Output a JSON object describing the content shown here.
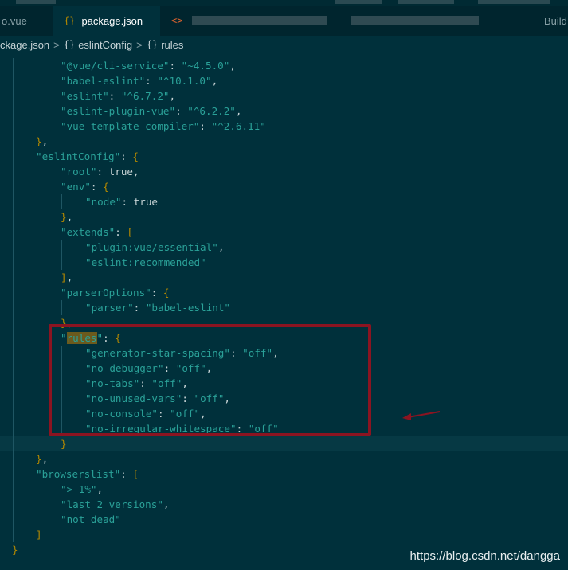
{
  "tabs": [
    {
      "label": "o.vue",
      "active": false
    },
    {
      "label": "package.json",
      "active": true,
      "icon_text": "{}"
    },
    {
      "label": "",
      "active": false,
      "icon_text": "<>",
      "obscured": true
    },
    {
      "label": "Build",
      "active": false
    }
  ],
  "breadcrumb": [
    "ckage.json",
    "eslintConfig",
    "rules"
  ],
  "colors": {
    "background": "#00303b",
    "string": "#2aa198",
    "brace": "#b58900",
    "annotation": "#8b1421"
  },
  "icons": {
    "json_file": "curly-braces-icon",
    "html_file": "angle-brackets-icon",
    "object": "object-braces-icon"
  },
  "code_lines": [
    {
      "indent": 2,
      "text": "\"@vue/cli-service\": \"~4.5.0\","
    },
    {
      "indent": 2,
      "text": "\"babel-eslint\": \"^10.1.0\","
    },
    {
      "indent": 2,
      "text": "\"eslint\": \"^6.7.2\","
    },
    {
      "indent": 2,
      "text": "\"eslint-plugin-vue\": \"^6.2.2\","
    },
    {
      "indent": 2,
      "text": "\"vue-template-compiler\": \"^2.6.11\""
    },
    {
      "indent": 1,
      "text": "},"
    },
    {
      "indent": 1,
      "text": "\"eslintConfig\": {"
    },
    {
      "indent": 2,
      "text": "\"root\": true,"
    },
    {
      "indent": 2,
      "text": "\"env\": {"
    },
    {
      "indent": 3,
      "text": "\"node\": true"
    },
    {
      "indent": 2,
      "text": "},"
    },
    {
      "indent": 2,
      "text": "\"extends\": ["
    },
    {
      "indent": 3,
      "text": "\"plugin:vue/essential\","
    },
    {
      "indent": 3,
      "text": "\"eslint:recommended\""
    },
    {
      "indent": 2,
      "text": "],"
    },
    {
      "indent": 2,
      "text": "\"parserOptions\": {"
    },
    {
      "indent": 3,
      "text": "\"parser\": \"babel-eslint\""
    },
    {
      "indent": 2,
      "text": "},"
    },
    {
      "indent": 2,
      "text": "\"rules\": {",
      "highlight": "rules"
    },
    {
      "indent": 3,
      "text": "\"generator-star-spacing\": \"off\","
    },
    {
      "indent": 3,
      "text": "\"no-debugger\": \"off\","
    },
    {
      "indent": 3,
      "text": "\"no-tabs\": \"off\","
    },
    {
      "indent": 3,
      "text": "\"no-unused-vars\": \"off\","
    },
    {
      "indent": 3,
      "text": "\"no-console\": \"off\","
    },
    {
      "indent": 3,
      "text": "\"no-irregular-whitespace\": \"off\""
    },
    {
      "indent": 2,
      "text": "}",
      "current": true
    },
    {
      "indent": 1,
      "text": "},"
    },
    {
      "indent": 1,
      "text": "\"browserslist\": ["
    },
    {
      "indent": 2,
      "text": "\"> 1%\","
    },
    {
      "indent": 2,
      "text": "\"last 2 versions\","
    },
    {
      "indent": 2,
      "text": "\"not dead\""
    },
    {
      "indent": 1,
      "text": "]"
    },
    {
      "indent": 0,
      "text": "}"
    }
  ],
  "watermark": "https://blog.csdn.net/dangga"
}
